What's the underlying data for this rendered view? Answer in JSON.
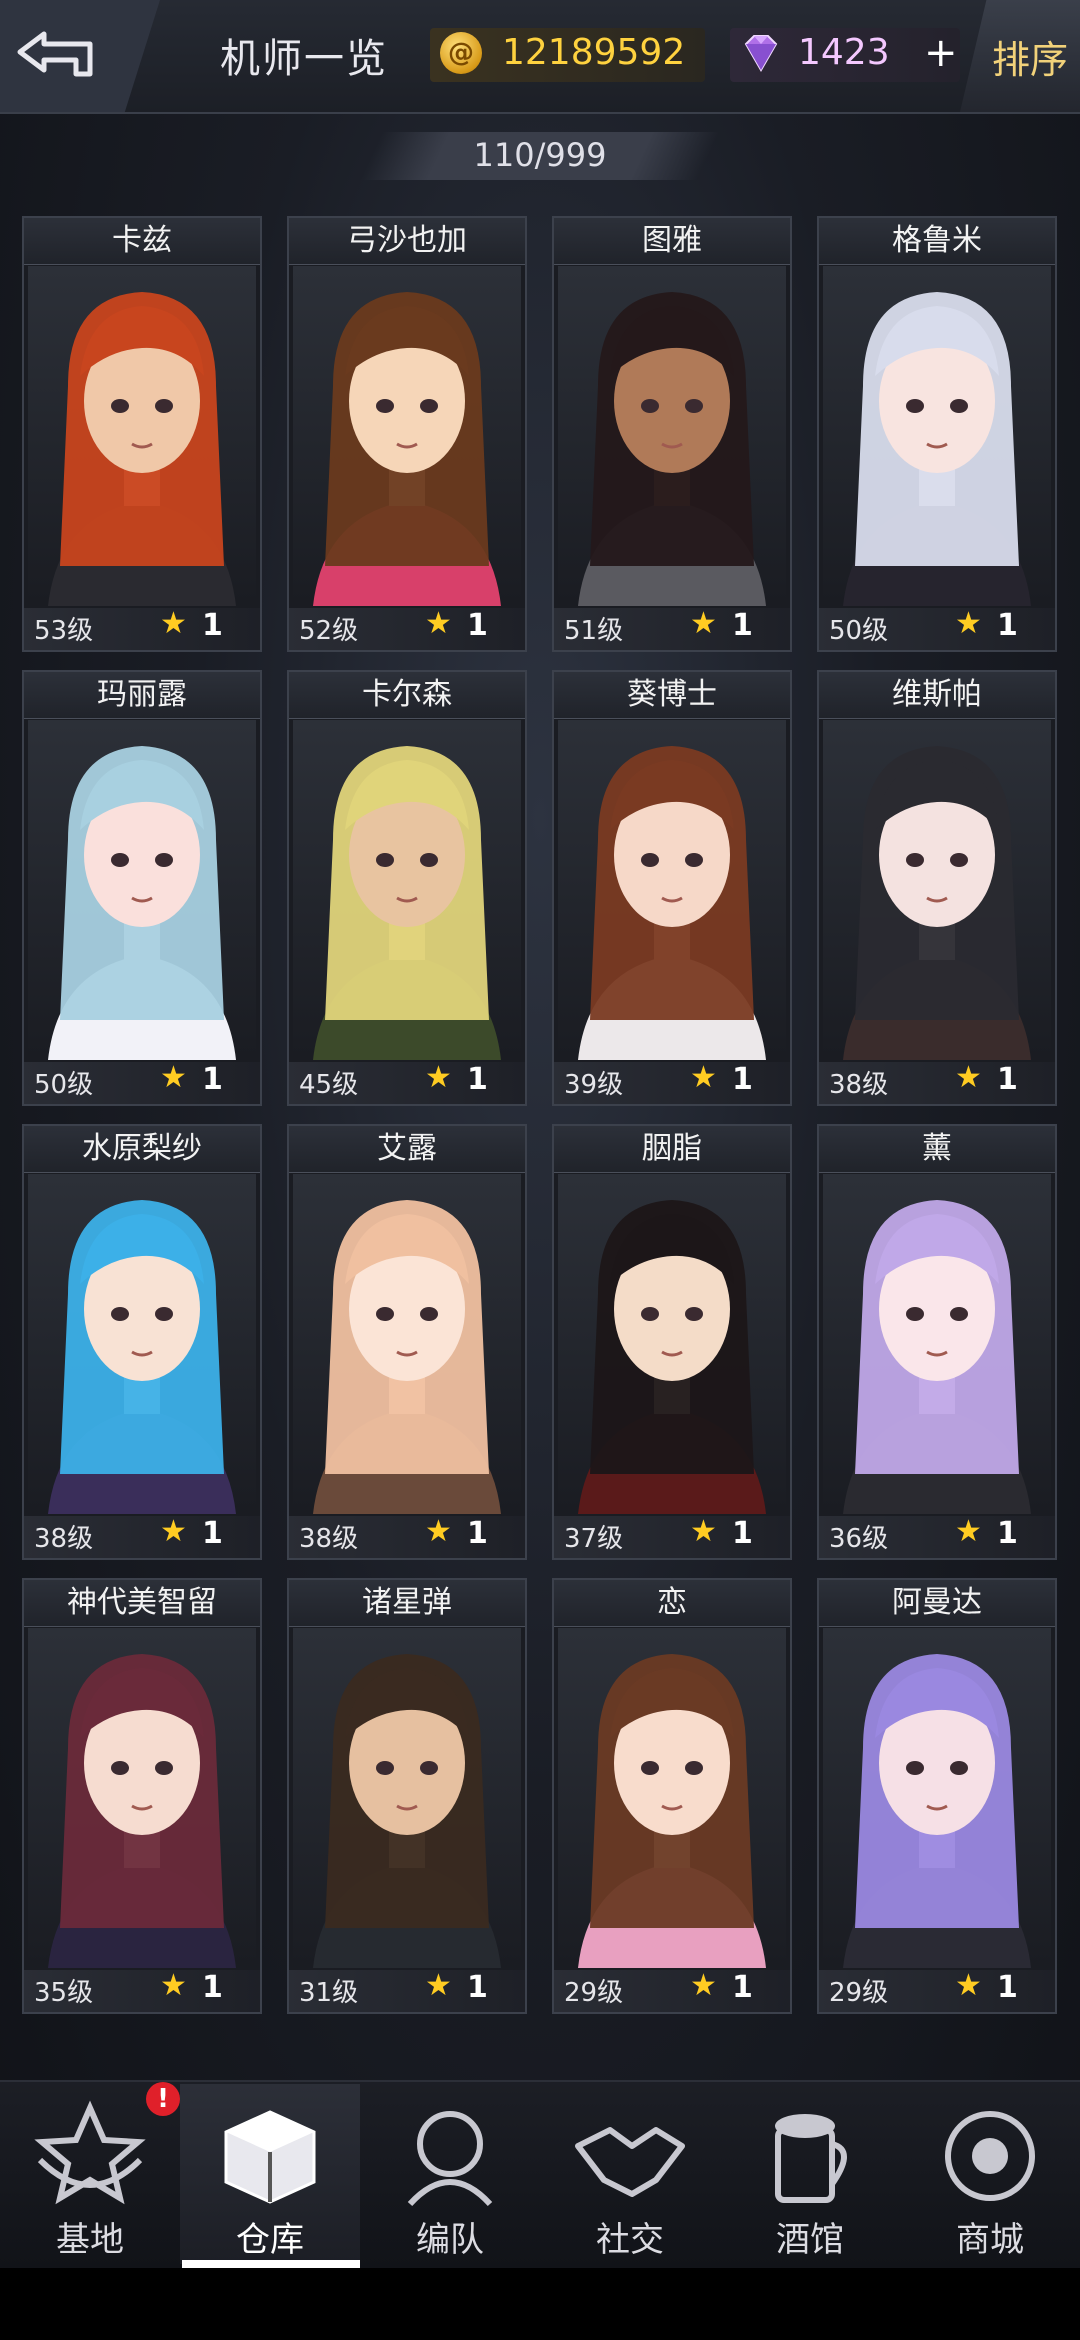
{
  "header": {
    "title": "机师一览",
    "coins": "12189592",
    "gems": "1423",
    "plus": "+",
    "sort_label": "排序",
    "count": "110/999"
  },
  "colors": {
    "accent_gold": "#ffd23f",
    "gem_pink": "#f4c8ff",
    "star_yellow": "#ffcc22",
    "badge_red": "#e0202a"
  },
  "pilots": [
    {
      "name": "卡兹",
      "level": "53级",
      "stars": "1",
      "hair": "#c8451e",
      "skin": "#f0c8a8",
      "outfit": "#2a2a30"
    },
    {
      "name": "弓沙也加",
      "level": "52级",
      "stars": "1",
      "hair": "#6a3a1e",
      "skin": "#f6d6b8",
      "outfit": "#d8406a"
    },
    {
      "name": "图雅",
      "level": "51级",
      "stars": "1",
      "hair": "#24181a",
      "skin": "#b07a58",
      "outfit": "#5a5a60"
    },
    {
      "name": "格鲁米",
      "level": "50级",
      "stars": "1",
      "hair": "#d8dcec",
      "skin": "#f8e4e0",
      "outfit": "#26242e"
    },
    {
      "name": "玛丽露",
      "level": "50级",
      "stars": "1",
      "hair": "#a8d0e0",
      "skin": "#fae0dc",
      "outfit": "#f2f2f8"
    },
    {
      "name": "卡尔森",
      "level": "45级",
      "stars": "1",
      "hair": "#e0d47a",
      "skin": "#e8c4a0",
      "outfit": "#3c4a2a"
    },
    {
      "name": "葵博士",
      "level": "39级",
      "stars": "1",
      "hair": "#7a3a22",
      "skin": "#f6d8c8",
      "outfit": "#ece8ea"
    },
    {
      "name": "维斯帕",
      "level": "38级",
      "stars": "1",
      "hair": "#2a2a30",
      "skin": "#f4e2e0",
      "outfit": "#3a2c2c"
    },
    {
      "name": "水原梨纱",
      "level": "38级",
      "stars": "1",
      "hair": "#3cb0e8",
      "skin": "#f8e2d4",
      "outfit": "#3a2e5a"
    },
    {
      "name": "艾露",
      "level": "38级",
      "stars": "1",
      "hair": "#f0c0a0",
      "skin": "#fbe4d6",
      "outfit": "#6a4a3a"
    },
    {
      "name": "胭脂",
      "level": "37级",
      "stars": "1",
      "hair": "#1c1618",
      "skin": "#f4dcc8",
      "outfit": "#5a1a1a"
    },
    {
      "name": "薰",
      "level": "36级",
      "stars": "1",
      "hair": "#c0a8e8",
      "skin": "#fae6ea",
      "outfit": "#2a2a30"
    },
    {
      "name": "神代美智留",
      "level": "35级",
      "stars": "1",
      "hair": "#6a2a3a",
      "skin": "#f6dcd0",
      "outfit": "#2a2440"
    },
    {
      "name": "诸星弹",
      "level": "31级",
      "stars": "1",
      "hair": "#3a2a20",
      "skin": "#e6c0a0",
      "outfit": "#262a30"
    },
    {
      "name": "恋",
      "level": "29级",
      "stars": "1",
      "hair": "#6a3a24",
      "skin": "#f8dccc",
      "outfit": "#e8a0c0"
    },
    {
      "name": "阿曼达",
      "level": "29级",
      "stars": "1",
      "hair": "#9a88e0",
      "skin": "#f6e0e6",
      "outfit": "#2a2a34"
    }
  ],
  "nav": [
    {
      "label": "基地",
      "icon": "base-icon"
    },
    {
      "label": "仓库",
      "icon": "warehouse-icon"
    },
    {
      "label": "编队",
      "icon": "team-icon"
    },
    {
      "label": "社交",
      "icon": "handshake-icon"
    },
    {
      "label": "酒馆",
      "icon": "tavern-icon"
    },
    {
      "label": "商城",
      "icon": "shop-icon"
    }
  ],
  "nav_badge": "!"
}
